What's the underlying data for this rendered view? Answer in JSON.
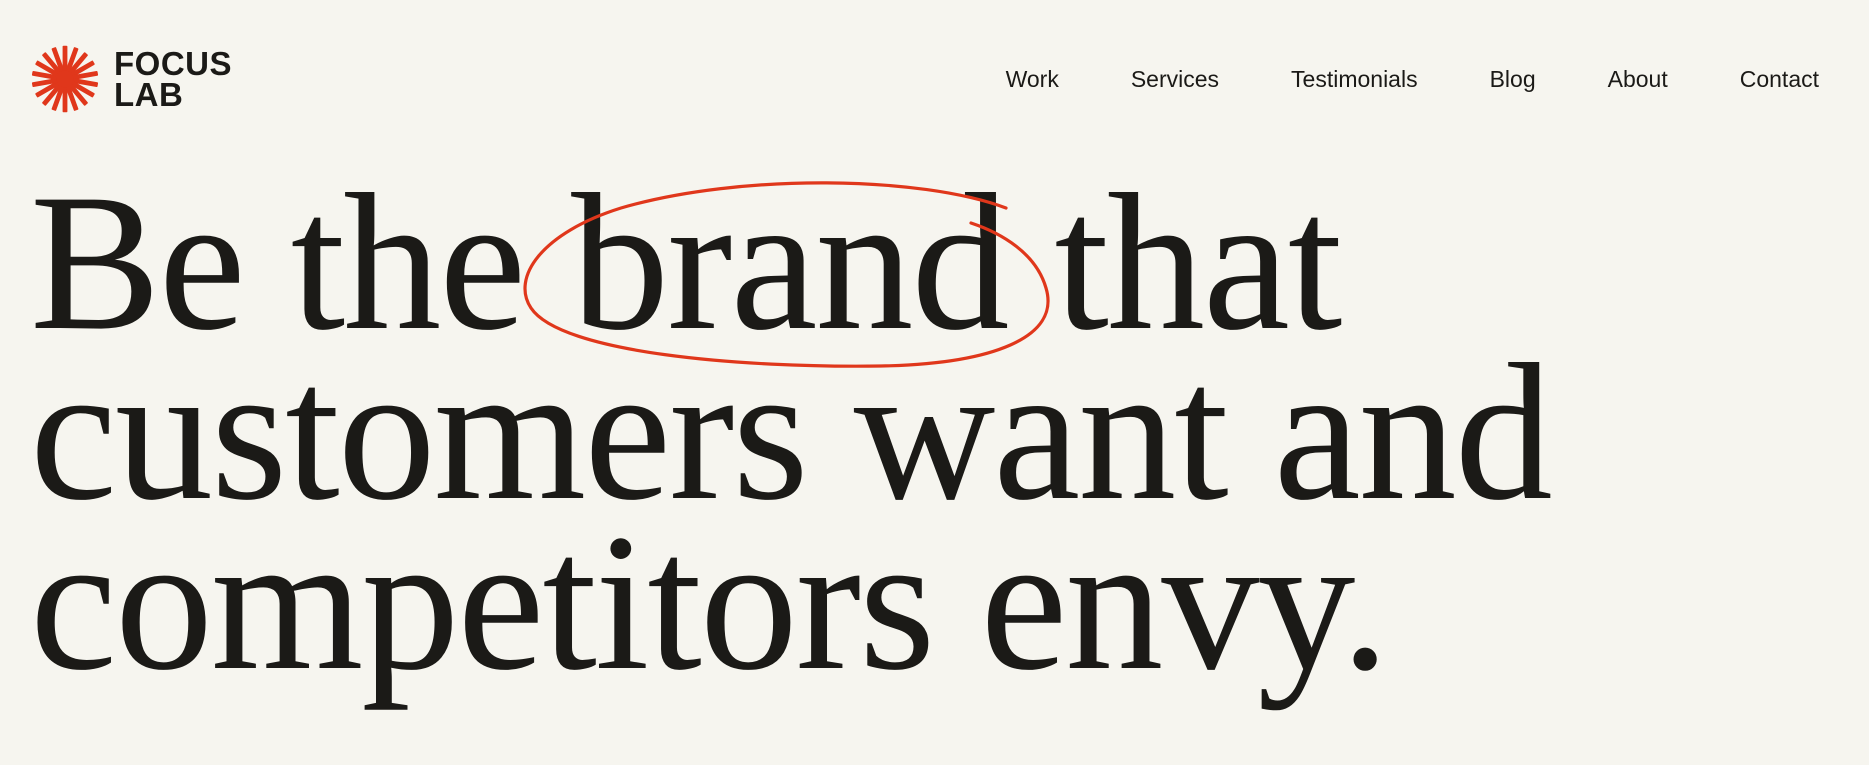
{
  "brand": {
    "name_line1": "FOCUS",
    "name_line2": "LAB",
    "logo_icon": "sunburst-icon",
    "accent_color": "#e0371b"
  },
  "nav": {
    "items": [
      {
        "label": "Work"
      },
      {
        "label": "Services"
      },
      {
        "label": "Testimonials"
      },
      {
        "label": "Blog"
      },
      {
        "label": "About"
      },
      {
        "label": "Contact"
      }
    ]
  },
  "hero": {
    "line1_before": "Be the ",
    "line1_highlight": "brand",
    "line1_after": " that",
    "line2": "customers want and",
    "line3": "competitors envy."
  },
  "colors": {
    "background": "#f6f5ef",
    "text": "#1b1a17",
    "accent": "#e0371b"
  }
}
